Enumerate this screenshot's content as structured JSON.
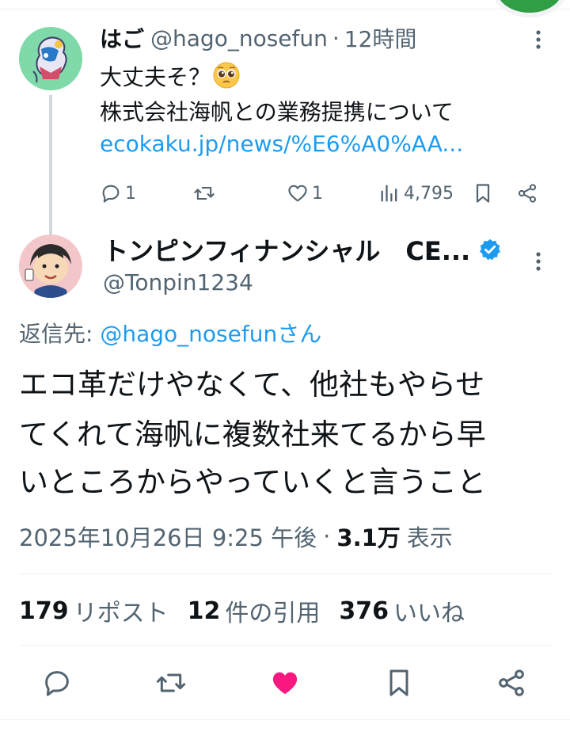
{
  "colors": {
    "link": "#1d9bf0",
    "muted": "#536471",
    "text": "#0f1419",
    "like_active": "#f91880",
    "verified": "#1d9bf0"
  },
  "parent_tweet": {
    "name": "はご",
    "handle": "@hago_nosefun",
    "separator": "·",
    "time": "12時間",
    "line1": "大丈夫そ？",
    "line1_emoji": "pleading-face",
    "line2": "株式会社海帆との業務提携について",
    "link": "ecokaku.jp/news/%E6%A0%AA...",
    "replies": "1",
    "likes": "1",
    "views": "4,795"
  },
  "main_tweet": {
    "name": "トンピンフィナンシャル　CE...",
    "verified": true,
    "handle": "@Tonpin1234",
    "reply_prefix": "返信先: ",
    "reply_user": "@hago_nosefunさん",
    "text_lines": [
      "エコ革だけやなくて、他社もやらせ",
      "てくれて海帆に複数社来てるから早",
      "いところからやっていくと言うこと"
    ],
    "timestamp": "2025年10月26日 9:25 午後",
    "meta_separator": "·",
    "views_count": "3.1万",
    "views_label": "表示",
    "stats": {
      "reposts_count": "179",
      "reposts_label": "リポスト",
      "quotes_count": "12",
      "quotes_label": "件の引用",
      "likes_count": "376",
      "likes_label": "いいね"
    },
    "liked": true
  }
}
